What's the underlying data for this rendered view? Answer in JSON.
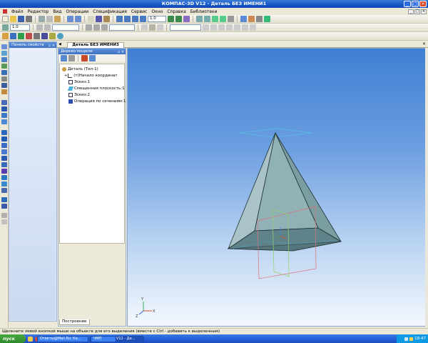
{
  "window": {
    "title": "КОМПАС-3D V12 - Деталь БЕЗ ИМЕНИ1",
    "buttons": {
      "minimize": "_",
      "maximize": "□",
      "close": "×"
    }
  },
  "menu": {
    "items": [
      "Файл",
      "Редактор",
      "Вид",
      "Операции",
      "Спецификация",
      "Сервис",
      "Окно",
      "Справка",
      "Библиотеки"
    ]
  },
  "toolbar2": {
    "scale_value": "1.0",
    "zoom_value": "1.0"
  },
  "properties_panel": {
    "title": "Панель свойств"
  },
  "document": {
    "tab_label": "Деталь БЕЗ ИМЕНИ3"
  },
  "model_tree": {
    "title": "Дерево модели",
    "items": [
      {
        "label": "Деталь (Тел-1)",
        "icon": "part-icon",
        "indent": 0
      },
      {
        "label": "(т)Начало координат",
        "icon": "origin-icon",
        "indent": 1
      },
      {
        "label": "Эскиз:1",
        "icon": "sketch-icon",
        "indent": 1
      },
      {
        "label": "Смещенная плоскость:1",
        "icon": "plane-icon",
        "indent": 1
      },
      {
        "label": "Эскиз:2",
        "icon": "sketch-icon",
        "indent": 1
      },
      {
        "label": "Операция по сечениям:1",
        "icon": "loft-icon",
        "indent": 1
      }
    ],
    "tab_label": "Построение"
  },
  "viewport": {
    "axes": {
      "x": "X",
      "y": "Y",
      "z": "Z"
    },
    "colors": {
      "pyramid_fill": "#93b3b7",
      "pyramid_dark": "#5a7a80",
      "edge": "#1d2f33",
      "section_frame": "#e0707a",
      "plane_green": "#8fd36a",
      "offset_plane": "#4fd0e0"
    }
  },
  "status": {
    "text": "Щелкните левой кнопкой мыши на объекте для его выделения (вместе с Ctrl - добавить к выделенным)"
  },
  "taskbar": {
    "start": "пуск",
    "tasks": [
      "КОМПАС-3D V12 - Де...",
      "Ответы@Mail.Ru: Ка...",
      "ЧМП"
    ],
    "clock": "18:47"
  }
}
